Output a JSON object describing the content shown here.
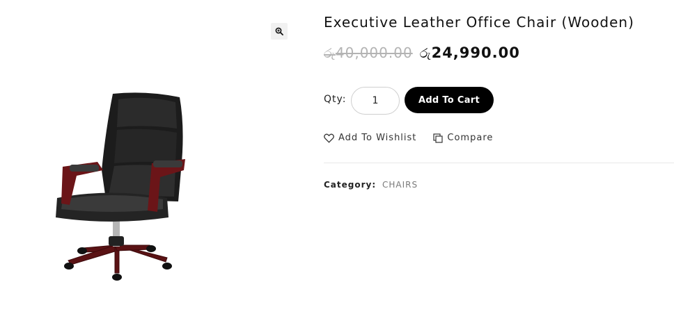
{
  "gallery": {
    "zoom_icon": "zoom-in-icon",
    "image_subject": "black-leather-executive-chair"
  },
  "product": {
    "title": "Executive Leather Office Chair (Wooden)",
    "old_price_currency": "රු",
    "old_price_amount": "40,000.00",
    "new_price_currency": "රු",
    "new_price_amount": "24,990.00"
  },
  "cart": {
    "qty_label": "Qty:",
    "qty_value": "1",
    "add_label": "Add To Cart"
  },
  "actions": {
    "wishlist_label": "Add To Wishlist",
    "wishlist_icon": "heart-icon",
    "compare_label": "Compare",
    "compare_icon": "compare-icon"
  },
  "meta": {
    "category_label": "Category:",
    "category_value": "CHAIRS"
  },
  "colors": {
    "button_bg": "#000000",
    "old_price": "#b3b3b3",
    "category_link": "#7a7a7a"
  }
}
